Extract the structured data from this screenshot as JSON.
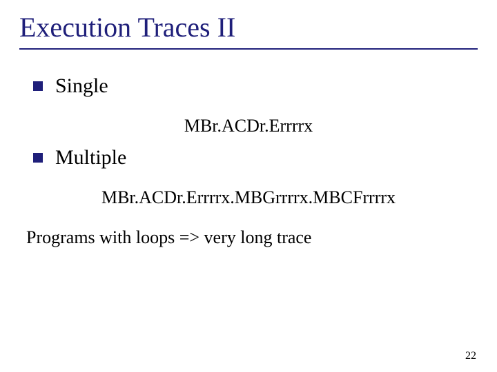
{
  "title": "Execution Traces II",
  "bullets": {
    "single": "Single",
    "multiple": "Multiple"
  },
  "trace_single": "MBr.ACDr.Errrrx",
  "trace_multiple": "MBr.ACDr.Errrrx.MBGrrrrx.MBCFrrrrx",
  "note": "Programs with loops => very long trace",
  "page_number": "22"
}
